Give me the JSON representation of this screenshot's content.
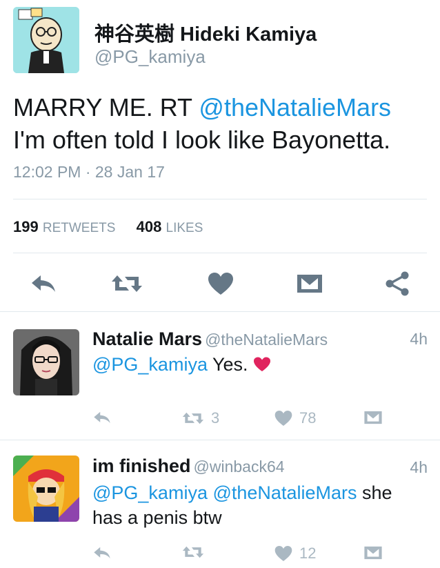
{
  "tweet": {
    "author_name": "神谷英樹 Hideki Kamiya",
    "author_handle": "@PG_kamiya",
    "text_part1": "MARRY ME. RT ",
    "text_mention": "@theNatalieMars",
    "text_part2": " I'm often told I look like Bayonetta.",
    "timestamp": "12:02 PM · 28 Jan 17",
    "retweets_count": "199",
    "retweets_label": "RETWEETS",
    "likes_count": "408",
    "likes_label": "LIKES"
  },
  "actions": [
    "reply-icon",
    "retweet-icon",
    "heart-icon",
    "dm-icon",
    "share-icon"
  ],
  "replies": [
    {
      "name": "Natalie Mars",
      "handle": "@theNatalieMars",
      "age": "4h",
      "mention1": "@PG_kamiya",
      "text": " Yes. ",
      "retweets": "3",
      "likes": "78"
    },
    {
      "name": "im finished",
      "handle": "@winback64",
      "age": "4h",
      "mention1": "@PG_kamiya",
      "mention2": "@theNatalieMars",
      "text": " she has a penis btw",
      "retweets": "",
      "likes": "12"
    }
  ],
  "colors": {
    "link": "#1b95e0",
    "muted": "#8899a6",
    "icon": "#657786",
    "heart": "#e0245e"
  }
}
